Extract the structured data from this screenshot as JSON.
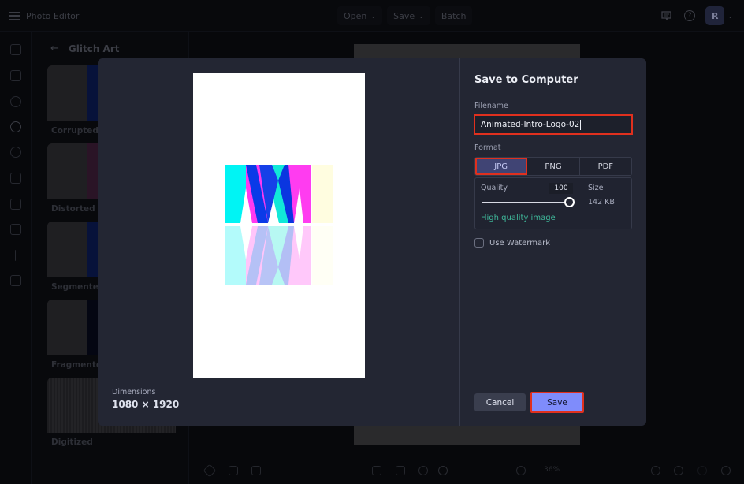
{
  "app": {
    "title": "Photo Editor"
  },
  "topbar": {
    "menu": [
      {
        "label": "Open",
        "chevron": "chevron-down"
      },
      {
        "label": "Save",
        "chevron": "chevron-down"
      },
      {
        "label": "Batch"
      }
    ],
    "feedback_icon": "feedback-icon",
    "help_icon": "help-icon",
    "help_glyph": "?",
    "avatar_initial": "R",
    "chevron_glyph": "⌄"
  },
  "rail": {
    "items": [
      "layout-icon",
      "adjust-icon",
      "effects-icon",
      "glitch-icon",
      "paint-icon",
      "frame-icon",
      "elements-icon",
      "texture-icon",
      "text-icon",
      "overlay-icon"
    ],
    "active_index": 3
  },
  "panel": {
    "back_glyph": "←",
    "title": "Glitch Art",
    "effects": [
      {
        "label": "Corrupted"
      },
      {
        "label": "Distorted"
      },
      {
        "label": "Segmented"
      },
      {
        "label": "Fragmented"
      },
      {
        "label": "Digitized"
      }
    ]
  },
  "bottombar": {
    "zoom_percent": "36%",
    "zoom_out_glyph": "−",
    "zoom_in_glyph": "+"
  },
  "dialog": {
    "title": "Save to Computer",
    "dimensions_label": "Dimensions",
    "dimensions_value": "1080 × 1920",
    "filename_label": "Filename",
    "filename_value": "Animated-Intro-Logo-02",
    "format_label": "Format",
    "formats": [
      {
        "label": "JPG",
        "selected": true
      },
      {
        "label": "PNG",
        "selected": false
      },
      {
        "label": "PDF",
        "selected": false
      }
    ],
    "quality_label": "Quality",
    "quality_value": "100",
    "quality_fraction": 1.0,
    "size_label": "Size",
    "size_value": "142 KB",
    "quality_hint": "High quality image",
    "watermark_label": "Use Watermark",
    "watermark_checked": false,
    "cancel_label": "Cancel",
    "save_label": "Save"
  },
  "colors": {
    "accent": "#7f8cfb",
    "highlight": "#e0301e",
    "hint_green": "#3fb89a",
    "dialog_bg": "#232633"
  }
}
